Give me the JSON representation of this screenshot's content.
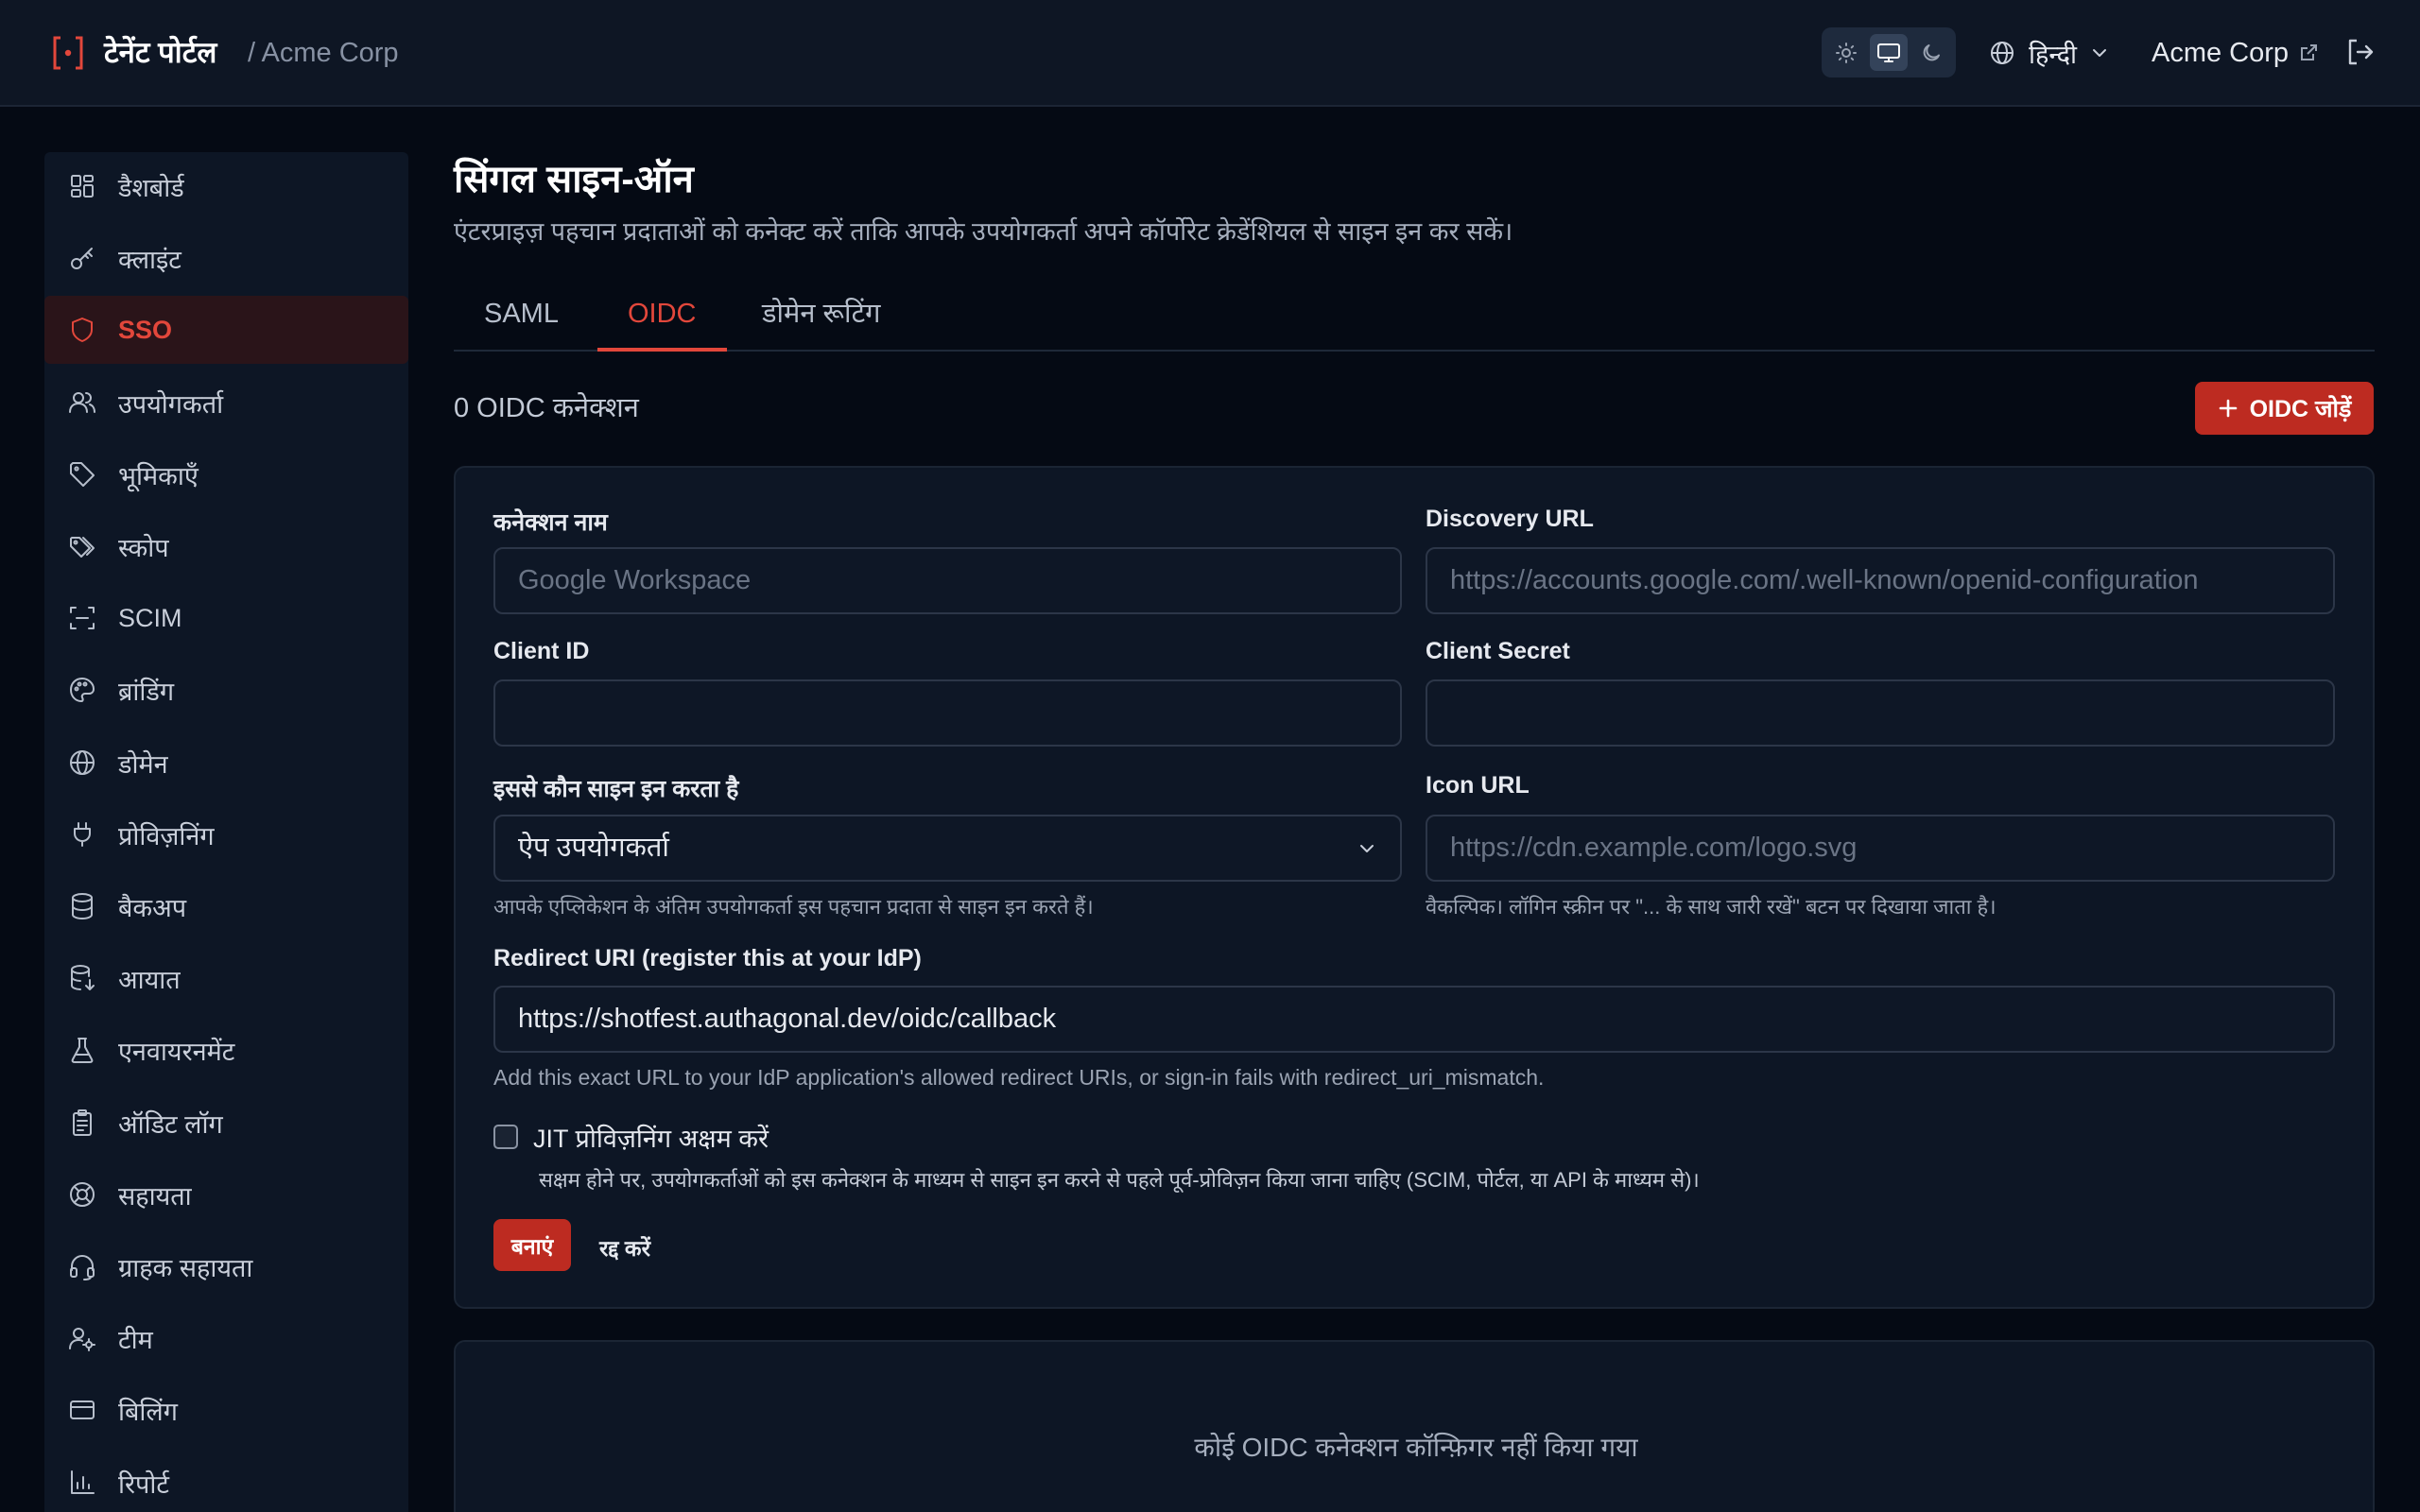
{
  "header": {
    "brand_name": "टेनेंट पोर्टल",
    "tenant_breadcrumb": "/ Acme Corp",
    "language_label": "हिन्दी",
    "tenant_link_label": "Acme Corp"
  },
  "sidebar": {
    "items": [
      {
        "label": "डैशबोर्ड",
        "icon": "dashboard-icon"
      },
      {
        "label": "क्लाइंट",
        "icon": "key-icon"
      },
      {
        "label": "SSO",
        "icon": "shield-icon",
        "active": true
      },
      {
        "label": "उपयोगकर्ता",
        "icon": "users-icon"
      },
      {
        "label": "भूमिकाएँ",
        "icon": "tag-icon"
      },
      {
        "label": "स्कोप",
        "icon": "tags-icon"
      },
      {
        "label": "SCIM",
        "icon": "scan-icon"
      },
      {
        "label": "ब्रांडिंग",
        "icon": "palette-icon"
      },
      {
        "label": "डोमेन",
        "icon": "globe-icon"
      },
      {
        "label": "प्रोविज़निंग",
        "icon": "plug-icon"
      },
      {
        "label": "बैकअप",
        "icon": "database-icon"
      },
      {
        "label": "आयात",
        "icon": "database-import-icon"
      },
      {
        "label": "एनवायरनमेंट",
        "icon": "flask-icon"
      },
      {
        "label": "ऑडिट लॉग",
        "icon": "clipboard-icon"
      },
      {
        "label": "सहायता",
        "icon": "lifebuoy-icon"
      },
      {
        "label": "ग्राहक सहायता",
        "icon": "headset-icon"
      },
      {
        "label": "टीम",
        "icon": "user-cog-icon"
      },
      {
        "label": "बिलिंग",
        "icon": "credit-card-icon"
      },
      {
        "label": "रिपोर्ट",
        "icon": "bar-chart-icon"
      }
    ]
  },
  "main": {
    "title": "सिंगल साइन-ऑन",
    "subtitle": "एंटरप्राइज़ पहचान प्रदाताओं को कनेक्ट करें ताकि आपके उपयोगकर्ता अपने कॉर्पोरेट क्रेडेंशियल से साइन इन कर सकें।",
    "tabs": [
      {
        "label": "SAML"
      },
      {
        "label": "OIDC",
        "active": true
      },
      {
        "label": "डोमेन रूटिंग"
      }
    ],
    "connection_count": "0 OIDC कनेक्शन",
    "add_button_label": "OIDC जोड़ें",
    "form": {
      "connection_name_label": "कनेक्शन नाम",
      "connection_name_placeholder": "Google Workspace",
      "discovery_url_label": "Discovery URL",
      "discovery_url_placeholder": "https://accounts.google.com/.well-known/openid-configuration",
      "client_id_label": "Client ID",
      "client_id_value": "",
      "client_secret_label": "Client Secret",
      "client_secret_value": "",
      "who_signs_in_label": "इससे कौन साइन इन करता है",
      "who_signs_in_value": "ऐप उपयोगकर्ता",
      "who_signs_in_hint": "आपके एप्लिकेशन के अंतिम उपयोगकर्ता इस पहचान प्रदाता से साइन इन करते हैं।",
      "icon_url_label": "Icon URL",
      "icon_url_placeholder": "https://cdn.example.com/logo.svg",
      "icon_url_hint": "वैकल्पिक। लॉगिन स्क्रीन पर \"... के साथ जारी रखें\" बटन पर दिखाया जाता है।",
      "redirect_uri_label": "Redirect URI (register this at your IdP)",
      "redirect_uri_value": "https://shotfest.authagonal.dev/oidc/callback",
      "redirect_uri_hint": "Add this exact URL to your IdP application's allowed redirect URIs, or sign-in fails with redirect_uri_mismatch.",
      "jit_label": "JIT प्रोविज़निंग अक्षम करें",
      "jit_checked": false,
      "jit_hint": "सक्षम होने पर, उपयोगकर्ताओं को इस कनेक्शन के माध्यम से साइन इन करने से पहले पूर्व-प्रोविज़न किया जाना चाहिए (SCIM, पोर्टल, या API के माध्यम से)।",
      "create_label": "बनाएं",
      "cancel_label": "रद्द करें"
    },
    "empty_state": "कोई OIDC कनेक्शन कॉन्फ़िगर नहीं किया गया"
  },
  "colors": {
    "accent": "#bd2b21",
    "accent_text": "#e2473b",
    "background": "#050a14",
    "panel": "#0d1625"
  }
}
